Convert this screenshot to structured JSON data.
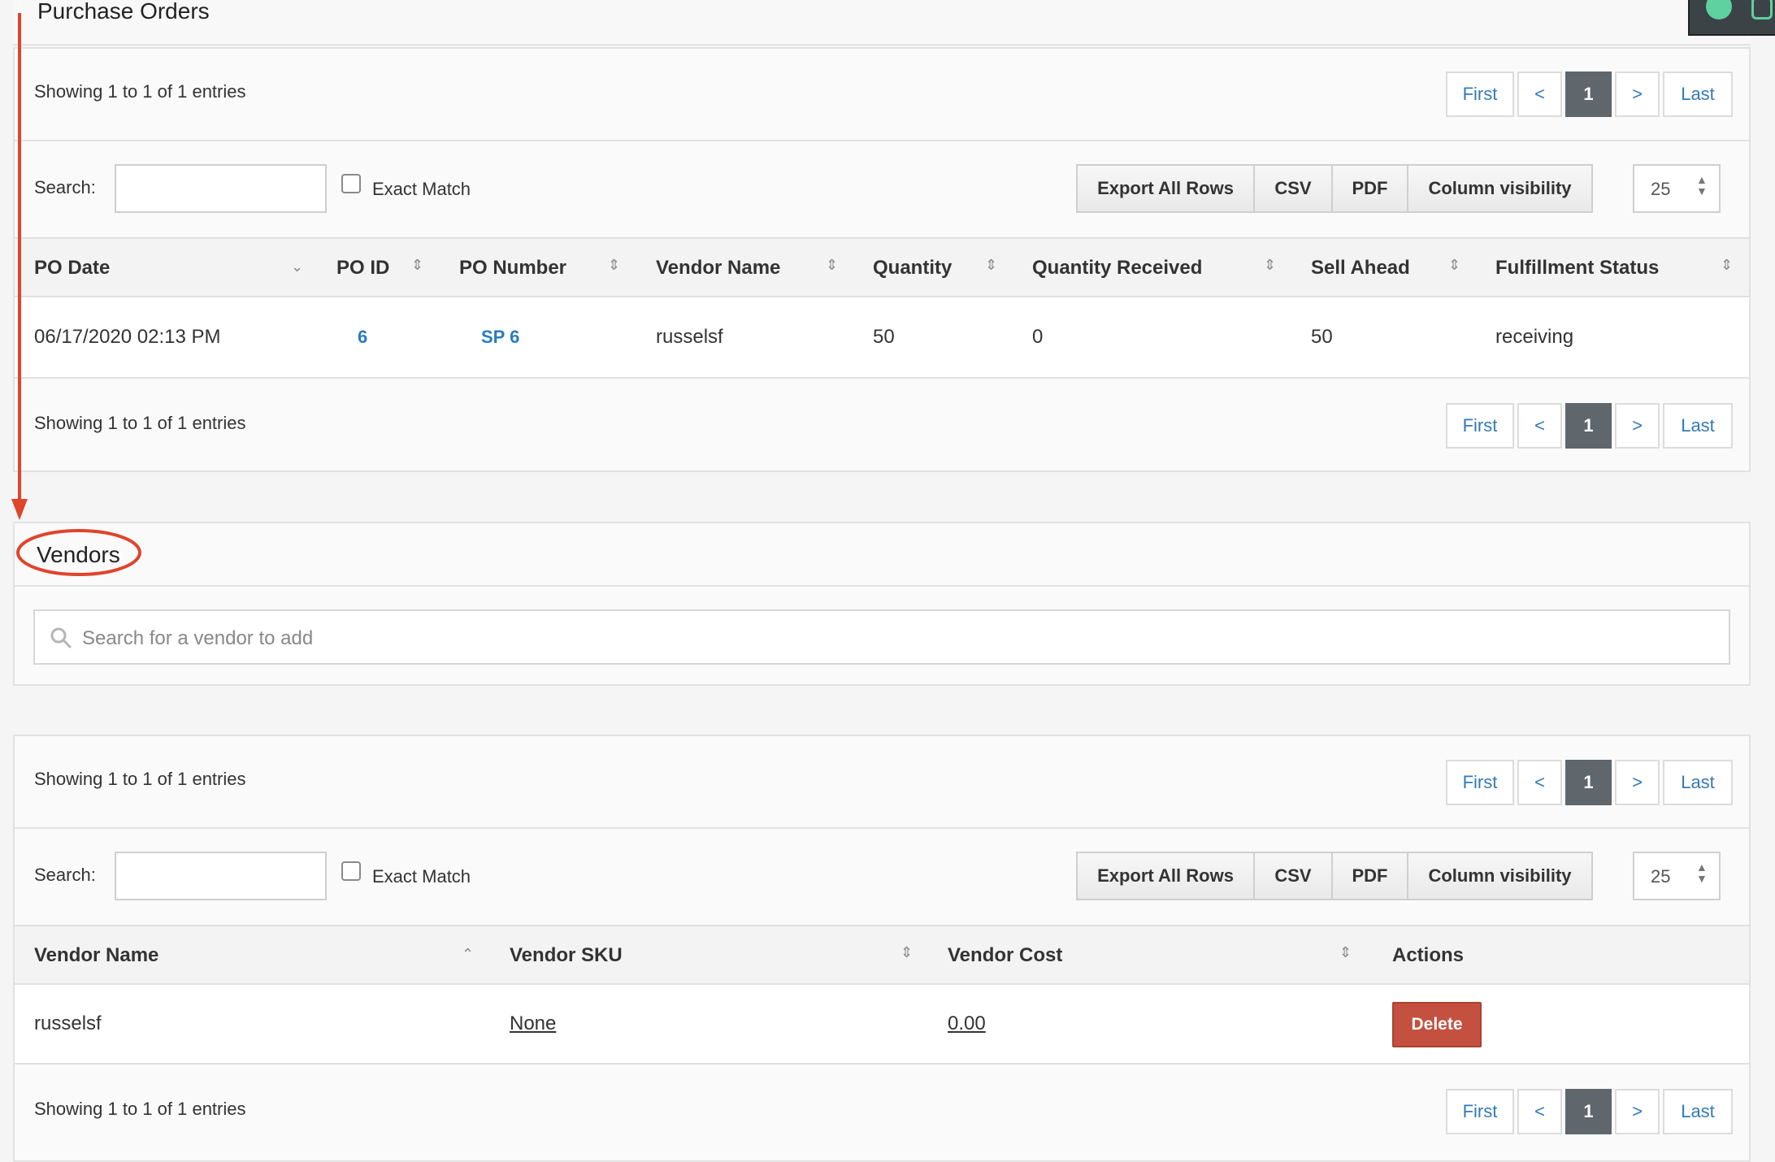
{
  "purchase_orders": {
    "title": "Purchase Orders",
    "info_top": "Showing 1 to 1 of 1 entries",
    "info_bottom": "Showing 1 to 1 of 1 entries",
    "pager": {
      "first": "First",
      "prev": "<",
      "current": "1",
      "next": ">",
      "last": "Last"
    },
    "search_label": "Search:",
    "exact_match_label": "Exact Match",
    "export_buttons": [
      "Export All Rows",
      "CSV",
      "PDF",
      "Column visibility"
    ],
    "page_length": "25",
    "columns": [
      "PO Date",
      "PO ID",
      "PO Number",
      "Vendor Name",
      "Quantity",
      "Quantity Received",
      "Sell Ahead",
      "Fulfillment Status"
    ],
    "rows": [
      {
        "po_date": "06/17/2020 02:13 PM",
        "po_id": "6",
        "po_number": "SP 6",
        "vendor_name": "russelsf",
        "quantity": "50",
        "quantity_received": "0",
        "sell_ahead": "50",
        "fulfillment_status": "receiving"
      }
    ]
  },
  "vendors": {
    "title": "Vendors",
    "search_placeholder": "Search for a vendor to add",
    "info_top": "Showing 1 to 1 of 1 entries",
    "info_bottom": "Showing 1 to 1 of 1 entries",
    "pager": {
      "first": "First",
      "prev": "<",
      "current": "1",
      "next": ">",
      "last": "Last"
    },
    "search_label": "Search:",
    "exact_match_label": "Exact Match",
    "export_buttons": [
      "Export All Rows",
      "CSV",
      "PDF",
      "Column visibility"
    ],
    "page_length": "25",
    "columns": [
      "Vendor Name",
      "Vendor SKU",
      "Vendor Cost",
      "Actions"
    ],
    "rows": [
      {
        "vendor_name": "russelsf",
        "vendor_sku": "None",
        "vendor_cost": "0.00",
        "action": "Delete"
      }
    ]
  },
  "annotation": {
    "arrow_color": "#e0442b",
    "highlight_color": "#e0442b"
  },
  "colors": {
    "link": "#2a7bbf",
    "delete": "#c4503f",
    "pager_active": "#5f666c"
  }
}
